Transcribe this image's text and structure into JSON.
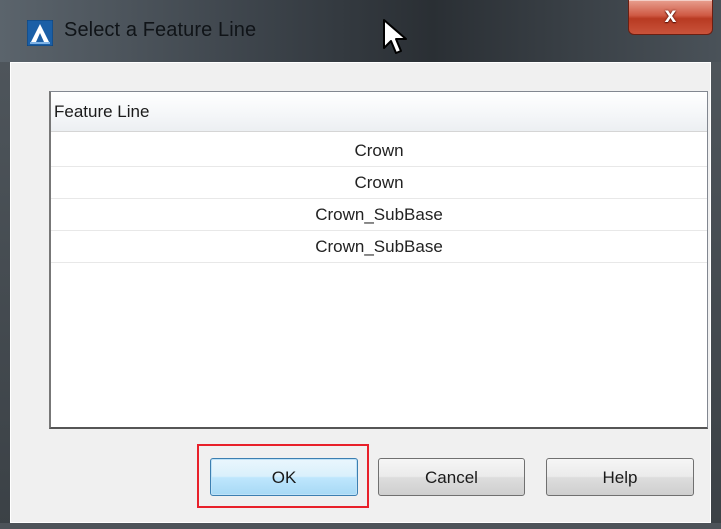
{
  "window": {
    "title": "Select a Feature Line",
    "close_label": "x"
  },
  "list": {
    "column_header": "Feature Line",
    "rows": [
      "Crown",
      "Crown",
      "Crown_SubBase",
      "Crown_SubBase"
    ]
  },
  "buttons": {
    "ok": "OK",
    "cancel": "Cancel",
    "help": "Help"
  },
  "icons": {
    "app": "autodesk-civil3d-icon",
    "cursor": "mouse-pointer-icon"
  },
  "colors": {
    "highlight": "#e8202a",
    "default_button_border": "#3c7fb1",
    "close_button": "#c9533b"
  }
}
